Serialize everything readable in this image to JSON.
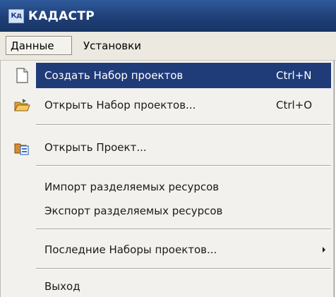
{
  "window": {
    "title": "КАДАСТР",
    "icon_text": "Кд"
  },
  "menubar": {
    "items": [
      {
        "label": "Данные"
      },
      {
        "label": "Установки"
      }
    ]
  },
  "dropdown": {
    "items": [
      {
        "label": "Создать Набор проектов",
        "shortcut": "Ctrl+N",
        "icon": "new-document-icon"
      },
      {
        "label": "Открыть Набор проектов...",
        "shortcut": "Ctrl+O",
        "icon": "open-folder-icon"
      },
      {
        "label": "Открыть Проект...",
        "shortcut": "",
        "icon": "open-project-icon"
      },
      {
        "label": "Импорт разделяемых ресурсов",
        "shortcut": ""
      },
      {
        "label": "Экспорт разделяемых ресурсов",
        "shortcut": ""
      },
      {
        "label": "Последние Наборы проектов...",
        "shortcut": "",
        "has_submenu": true
      },
      {
        "label": "Выход",
        "shortcut": ""
      }
    ]
  },
  "colors": {
    "titlebar": "#1f3f78",
    "highlight": "#1f3b78",
    "menu_background": "#f2f1ee"
  }
}
